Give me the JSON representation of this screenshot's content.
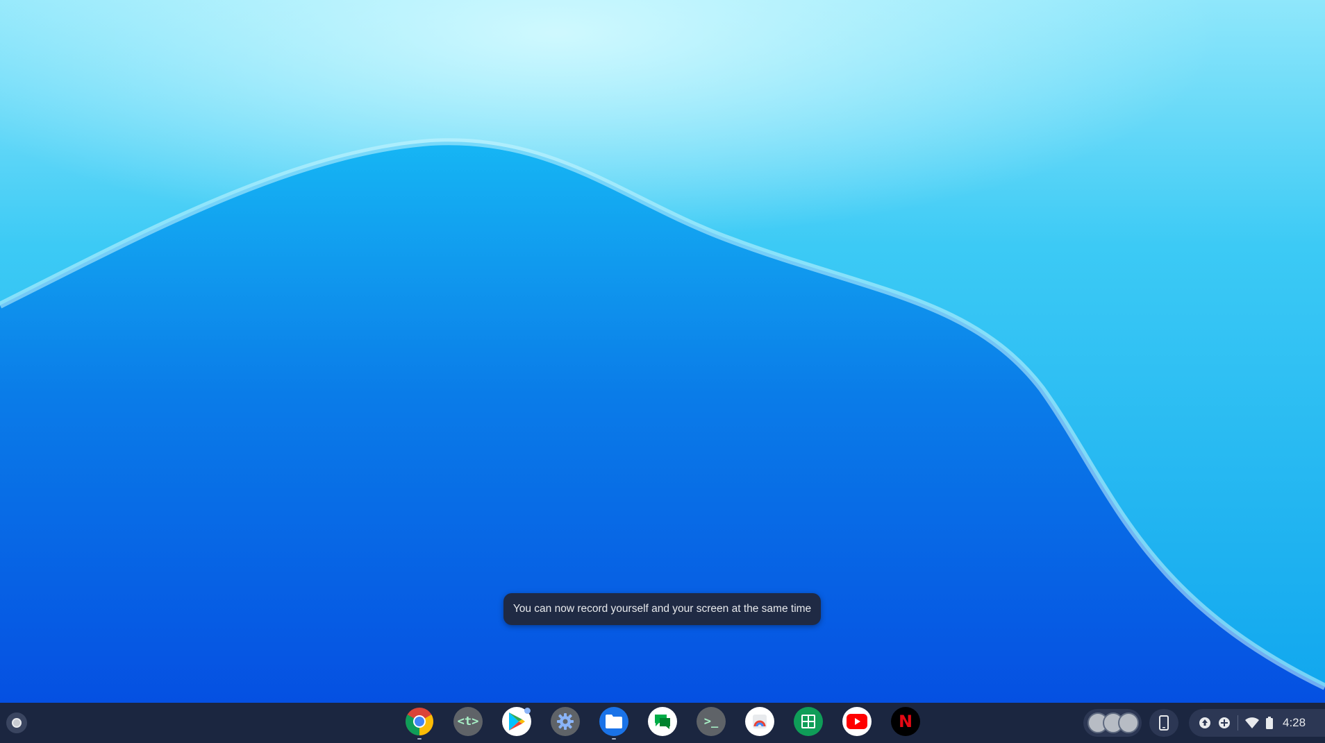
{
  "toast": {
    "message": "You can now record yourself and your screen at the same time"
  },
  "shelf": {
    "launcher_icon": "launcher-circle-icon",
    "apps": [
      {
        "name": "chrome",
        "icon": "chrome-icon",
        "running": true
      },
      {
        "name": "text-editor",
        "icon": "text-editor-icon",
        "label": "<t>",
        "running": false
      },
      {
        "name": "play-store",
        "icon": "play-store-icon",
        "running": false
      },
      {
        "name": "settings",
        "icon": "settings-gear-icon",
        "running": false
      },
      {
        "name": "files",
        "icon": "files-folder-icon",
        "running": true
      },
      {
        "name": "chat",
        "icon": "chat-icon",
        "running": false
      },
      {
        "name": "terminal",
        "icon": "terminal-icon",
        "label": ">_",
        "running": false
      },
      {
        "name": "diagnostics",
        "icon": "diagnostics-icon",
        "running": false
      },
      {
        "name": "sheets",
        "icon": "sheets-icon",
        "running": false
      },
      {
        "name": "youtube",
        "icon": "youtube-icon",
        "running": false
      },
      {
        "name": "netflix",
        "icon": "netflix-icon",
        "label": "N",
        "running": false
      }
    ]
  },
  "status_tray": {
    "clock": "4:28",
    "icons": [
      "upload-icon",
      "add-circle-icon",
      "wifi-icon",
      "battery-icon"
    ]
  },
  "colors": {
    "shelf": "#1b2640",
    "toast": "#1f2a44",
    "accent": "#0a57e6"
  }
}
